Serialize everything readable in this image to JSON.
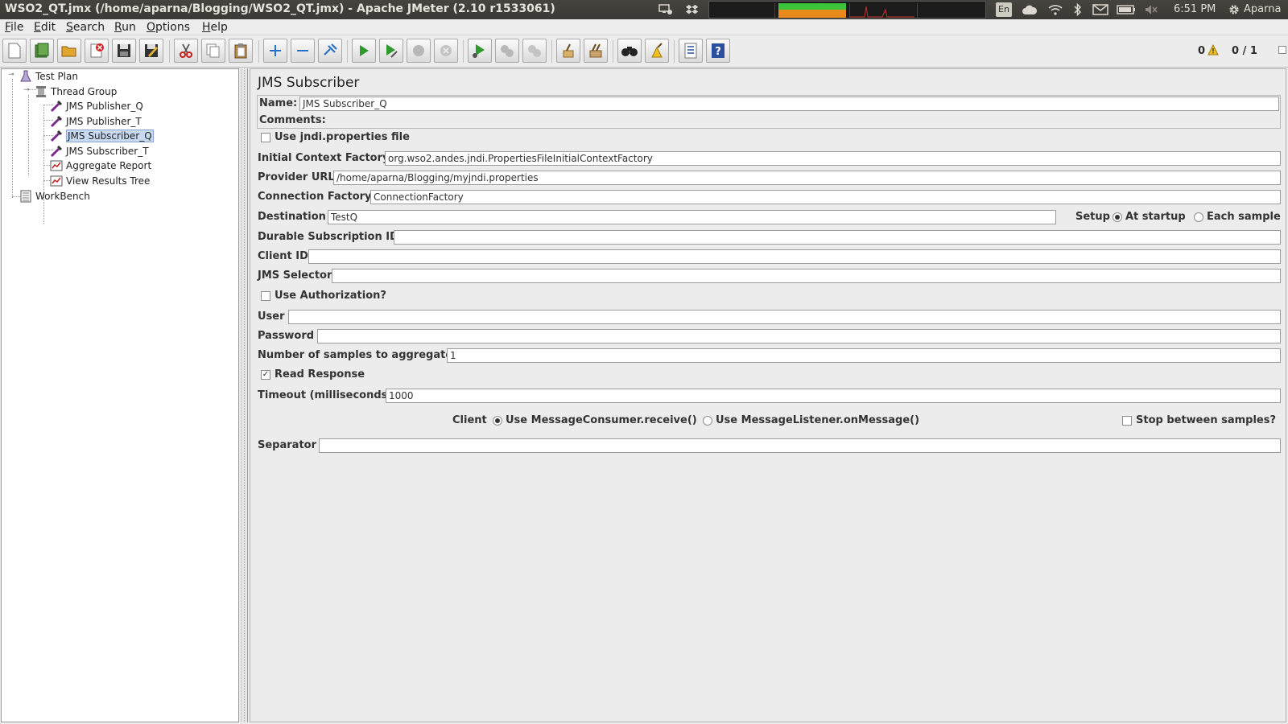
{
  "window": {
    "title": "WSO2_QT.jmx (/home/aparna/Blogging/WSO2_QT.jmx) - Apache JMeter (2.10 r1533061)"
  },
  "system_tray": {
    "keyboard_layout": "En",
    "clock": "6:51 PM",
    "user": "Aparna",
    "icons": [
      "display-network-icon",
      "dropbox-icon",
      "system-monitor",
      "keyboard-layout",
      "cloud-icon",
      "wifi-icon",
      "bluetooth-icon",
      "mail-icon",
      "battery-icon",
      "volume-muted-icon",
      "gear-icon"
    ]
  },
  "menu": [
    "File",
    "Edit",
    "Search",
    "Run",
    "Options",
    "Help"
  ],
  "toolbar": {
    "buttons": [
      "new-icon",
      "templates-icon",
      "open-icon",
      "close-icon",
      "save-icon",
      "save-as-icon",
      "cut-icon",
      "copy-icon",
      "paste-icon",
      "expand-icon",
      "collapse-icon",
      "toggle-icon",
      "start-icon",
      "start-no-timers-icon",
      "stop-icon",
      "shutdown-icon",
      "remote-start-icon",
      "remote-stop-icon",
      "remote-shutdown-icon",
      "clear-icon",
      "clear-all-icon",
      "search-icon",
      "reset-search-icon",
      "function-helper-icon",
      "help-icon"
    ],
    "warning_count": "0",
    "thread_count": "0 / 1"
  },
  "tree": {
    "items": [
      {
        "label": "Test Plan"
      },
      {
        "label": "Thread Group"
      },
      {
        "label": "JMS Publisher_Q"
      },
      {
        "label": "JMS Publisher_T"
      },
      {
        "label": "JMS Subscriber_Q",
        "selected": true
      },
      {
        "label": "JMS Subscriber_T"
      },
      {
        "label": "Aggregate Report"
      },
      {
        "label": "View Results Tree"
      },
      {
        "label": "WorkBench"
      }
    ]
  },
  "form": {
    "heading": "JMS Subscriber",
    "name_label": "Name:",
    "name_value": "JMS Subscriber_Q",
    "comments_label": "Comments:",
    "comments_value": "",
    "use_jndi_label": "Use jndi.properties file",
    "use_jndi_checked": false,
    "icf_label": "Initial Context Factory",
    "icf_value": "org.wso2.andes.jndi.PropertiesFileInitialContextFactory",
    "provider_url_label": "Provider URL",
    "provider_url_value": "/home/aparna/Blogging/myjndi.properties",
    "conn_factory_label": "Connection Factory",
    "conn_factory_value": "ConnectionFactory",
    "destination_label": "Destination",
    "destination_value": "TestQ",
    "setup_label": "Setup",
    "setup_at_startup": "At startup",
    "setup_each_sample": "Each sample",
    "setup_selected": "At startup",
    "durable_label": "Durable Subscription ID",
    "durable_value": "",
    "client_id_label": "Client ID",
    "client_id_value": "",
    "selector_label": "JMS Selector",
    "selector_value": "",
    "use_auth_label": "Use Authorization?",
    "use_auth_checked": false,
    "user_label": "User",
    "user_value": "",
    "password_label": "Password",
    "password_value": "",
    "samples_label": "Number of samples to aggregate",
    "samples_value": "1",
    "read_response_label": "Read Response",
    "read_response_checked": true,
    "timeout_label": "Timeout (milliseconds)",
    "timeout_value": "1000",
    "client_label": "Client",
    "client_receive": "Use MessageConsumer.receive()",
    "client_listener": "Use MessageListener.onMessage()",
    "client_selected": "Use MessageConsumer.receive()",
    "stop_between_label": "Stop between samples?",
    "stop_between_checked": false,
    "separator_label": "Separator",
    "separator_value": ""
  },
  "colors": {
    "titlebar": "#3c3b37",
    "selection": "#c8daf2",
    "start_green": "#2e9a2e",
    "sysmon_green": "#3cc43c",
    "sysmon_orange": "#e88a1a"
  }
}
